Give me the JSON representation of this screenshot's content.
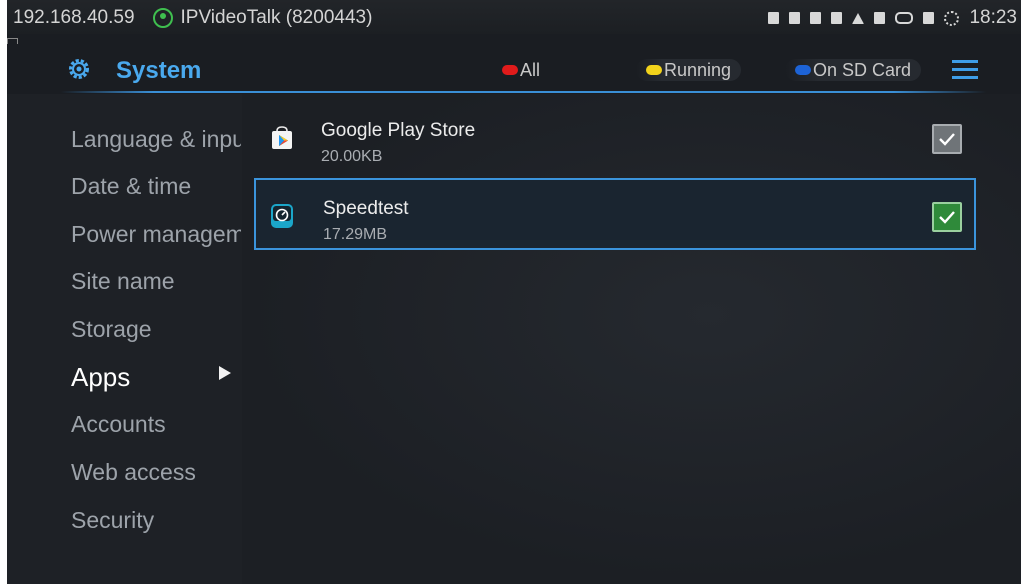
{
  "status_bar": {
    "ip": "192.168.40.59",
    "service": "IPVideoTalk (8200443)",
    "time": "18:23",
    "icons": [
      "screenshot-icon",
      "calendar-icon",
      "camera-icon",
      "lock-icon",
      "warning-icon",
      "keyboard-icon",
      "cloud-icon",
      "sd-card-icon",
      "sync-icon"
    ]
  },
  "header": {
    "title": "System",
    "filters": [
      {
        "label": "All",
        "color": "#e11b1b"
      },
      {
        "label": "Running",
        "color": "#f2d31b"
      },
      {
        "label": "On SD Card",
        "color": "#1d63d6"
      }
    ]
  },
  "sidebar": {
    "items": [
      {
        "label": "Language & input"
      },
      {
        "label": "Date & time"
      },
      {
        "label": "Power management"
      },
      {
        "label": "Site name"
      },
      {
        "label": "Storage"
      },
      {
        "label": "Apps",
        "active": true
      },
      {
        "label": "Accounts"
      },
      {
        "label": "Web access"
      },
      {
        "label": "Security"
      }
    ]
  },
  "apps": [
    {
      "name": "Google Play Store",
      "size": "20.00KB",
      "checked": true,
      "selected": false,
      "icon": "play-store-icon"
    },
    {
      "name": "Speedtest",
      "size": "17.29MB",
      "checked": true,
      "selected": true,
      "icon": "speedtest-icon"
    }
  ],
  "colors": {
    "accent": "#3b94dc",
    "title": "#4aa9ee",
    "check_green": "#2f8a3a"
  }
}
